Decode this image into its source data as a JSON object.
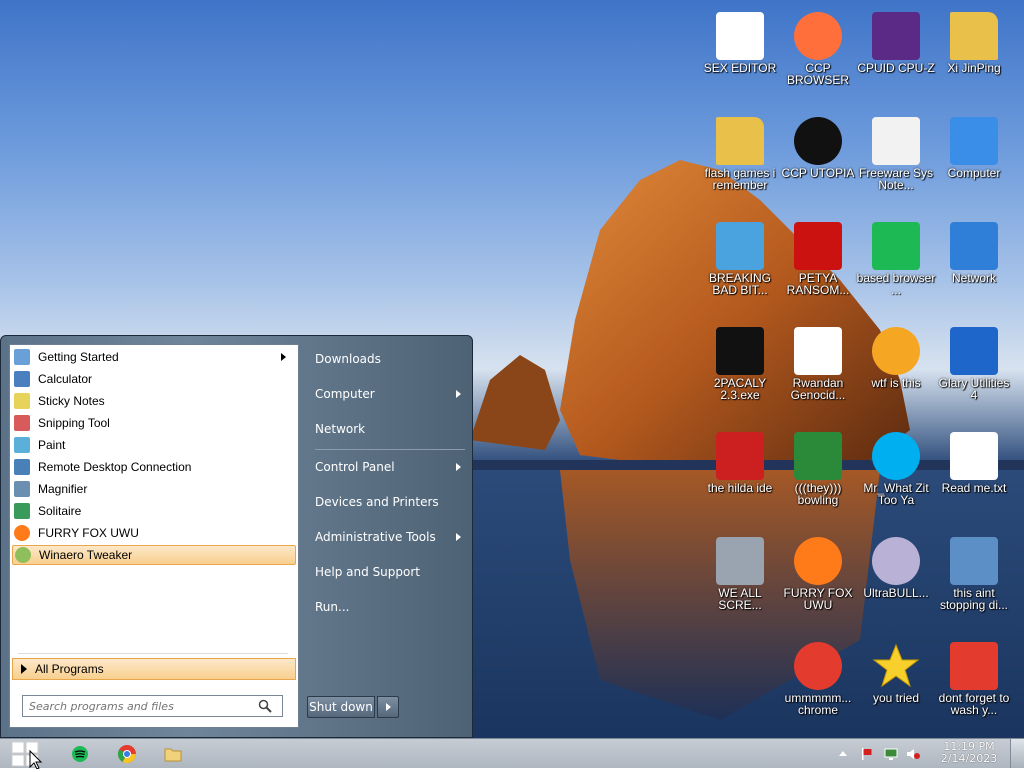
{
  "desktop": {
    "icons": [
      {
        "label": "SEX EDITOR",
        "icon": "hex-editor-icon",
        "color": "#ffffff"
      },
      {
        "label": "CCP BROWSER",
        "icon": "browser-orb-icon",
        "color": "#ff6f3c"
      },
      {
        "label": "CPUID CPU-Z",
        "icon": "cpu-z-icon",
        "color": "#5b2a86"
      },
      {
        "label": "Xi JinPing",
        "icon": "user-folder-icon",
        "color": "#e8c04a"
      },
      {
        "label": "flash games i remember",
        "icon": "folder-icon",
        "color": "#e8c04a"
      },
      {
        "label": "CCP UTOPIA",
        "icon": "black-round-icon",
        "color": "#111111"
      },
      {
        "label": "Freeware Sys Note...",
        "icon": "document-icon",
        "color": "#f2f2f2"
      },
      {
        "label": "Computer",
        "icon": "computer-icon",
        "color": "#3b8ee8"
      },
      {
        "label": "BREAKING BAD BIT...",
        "icon": "angry-birds-icon",
        "color": "#4aa3df"
      },
      {
        "label": "PETYA RANSOM...",
        "icon": "skull-icon",
        "color": "#cc1111"
      },
      {
        "label": "based browser ...",
        "icon": "spotify-green-icon",
        "color": "#1db954"
      },
      {
        "label": "Network",
        "icon": "network-globe-icon",
        "color": "#2f7fd8"
      },
      {
        "label": "2PACALY 2.3.exe",
        "icon": "cmd-terminal-icon",
        "color": "#111111"
      },
      {
        "label": "Rwandan Genocid...",
        "icon": "meme-face-icon",
        "color": "#ffffff"
      },
      {
        "label": "wtf is this",
        "icon": "aimp-triangle-icon",
        "color": "#f5a623"
      },
      {
        "label": "Glary Utilities 4",
        "icon": "glary-crescent-icon",
        "color": "#1e66c9"
      },
      {
        "label": "the hilda ide",
        "icon": "dev-cpp-icon",
        "color": "#cc1f1f"
      },
      {
        "label": "(((they))) bowling",
        "icon": "elf-bowling-icon",
        "color": "#2a8a3a"
      },
      {
        "label": "Mr_What Zit Too Ya",
        "icon": "skype-icon",
        "color": "#00aff0"
      },
      {
        "label": "Read me.txt",
        "icon": "text-file-icon",
        "color": "#ffffff"
      },
      {
        "label": "WE ALL SCRE...",
        "icon": "old-computer-icon",
        "color": "#9aa4b0"
      },
      {
        "label": "FURRY FOX UWU",
        "icon": "firefox-icon",
        "color": "#ff7a18"
      },
      {
        "label": "UltraBULL...",
        "icon": "disc-icon",
        "color": "#b9b2d6"
      },
      {
        "label": "this aint stopping di...",
        "icon": "magnifier-computer-icon",
        "color": "#5d8fc7"
      },
      {
        "label": "ummmmm... chrome",
        "icon": "chrome-icon",
        "color": "#e33b2e"
      },
      {
        "label": "you tried",
        "icon": "star-icon",
        "color": "#f7d02c"
      },
      {
        "label": "dont forget to wash y...",
        "icon": "ccleaner-icon",
        "color": "#e33b2e"
      }
    ]
  },
  "startmenu": {
    "programs": [
      {
        "label": "Getting Started",
        "icon": "getting-started-icon",
        "has_submenu": true
      },
      {
        "label": "Calculator",
        "icon": "calculator-icon"
      },
      {
        "label": "Sticky Notes",
        "icon": "sticky-notes-icon"
      },
      {
        "label": "Snipping Tool",
        "icon": "scissors-icon"
      },
      {
        "label": "Paint",
        "icon": "paint-icon"
      },
      {
        "label": "Remote Desktop Connection",
        "icon": "remote-desktop-icon"
      },
      {
        "label": "Magnifier",
        "icon": "magnifier-icon"
      },
      {
        "label": "Solitaire",
        "icon": "solitaire-icon"
      },
      {
        "label": "FURRY FOX UWU",
        "icon": "firefox-icon"
      },
      {
        "label": "Winaero Tweaker",
        "icon": "winaero-icon",
        "highlighted": true
      }
    ],
    "all_programs": "All Programs",
    "search_placeholder": "Search programs and files",
    "right_links": [
      {
        "label": "Downloads"
      },
      {
        "label": "Computer",
        "has_submenu": true
      },
      {
        "label": "Network"
      },
      {
        "label": "Control Panel",
        "has_submenu": true
      },
      {
        "label": "Devices and Printers"
      },
      {
        "label": "Administrative Tools",
        "has_submenu": true
      },
      {
        "label": "Help and Support"
      },
      {
        "label": "Run..."
      }
    ],
    "shutdown_label": "Shut down"
  },
  "taskbar": {
    "pinned": [
      "spotify-icon",
      "chrome-icon",
      "file-explorer-icon"
    ],
    "tray": [
      "show-hidden-icons-icon",
      "action-center-flag-icon",
      "network-icon",
      "volume-muted-icon"
    ],
    "time": "11:19 PM",
    "date": "2/14/2023"
  }
}
